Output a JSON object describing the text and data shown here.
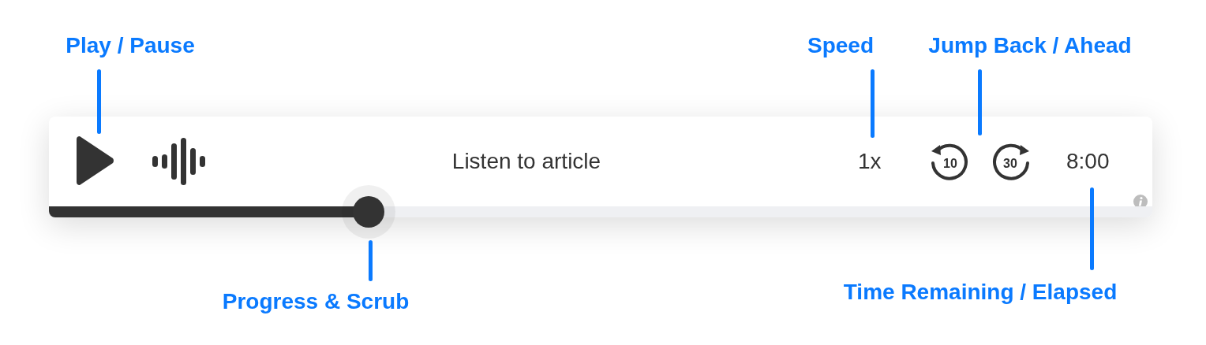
{
  "player": {
    "title": "Listen to article",
    "speed": "1x",
    "jump_back": "10",
    "jump_ahead": "30",
    "time": "8:00",
    "progress": {
      "level": 0.29
    }
  },
  "annotations": [
    {
      "label": "Play / Pause"
    },
    {
      "label": "Speed"
    },
    {
      "label": "Jump Back / Ahead"
    },
    {
      "label": "Progress & Scrub"
    },
    {
      "label": "Time Remaining / Elapsed"
    }
  ]
}
